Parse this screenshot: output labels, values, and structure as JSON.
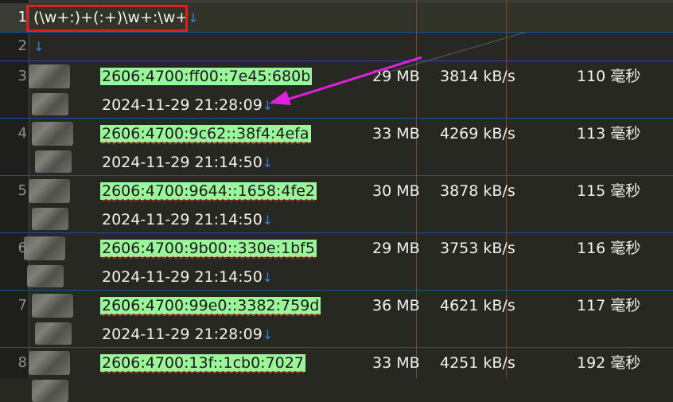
{
  "editor": {
    "line_numbers": [
      "1",
      "2",
      "3",
      "4",
      "5",
      "6",
      "7",
      "8"
    ],
    "regex_line": "(\\w+:)+(:+)\\w+:\\w+",
    "newline_marker": "↓",
    "colors": {
      "background": "#272822",
      "match_highlight": "#9bf59b",
      "arrow_annotation": "#e020e0",
      "regex_box": "#e11d1d",
      "rule_lines": "#1d4ea6",
      "column_guide": "#b36a3a"
    }
  },
  "entries": [
    {
      "line": "3",
      "ip": "2606:4700:ff00::7e45:680b",
      "size": "29 MB",
      "speed": "3814 kB/s",
      "latency": "110 毫秒",
      "date": "2024-11-29 21:28:09"
    },
    {
      "line": "4",
      "ip": "2606:4700:9c62::38f4:4efa",
      "size": "33 MB",
      "speed": "4269 kB/s",
      "latency": "113 毫秒",
      "date": "2024-11-29 21:14:50"
    },
    {
      "line": "5",
      "ip": "2606:4700:9644::1658:4fe2",
      "size": "30 MB",
      "speed": "3878 kB/s",
      "latency": "115 毫秒",
      "date": "2024-11-29 21:14:50"
    },
    {
      "line": "6",
      "ip": "2606:4700:9b00::330e:1bf5",
      "size": "29 MB",
      "speed": "3753 kB/s",
      "latency": "116 毫秒",
      "date": "2024-11-29 21:14:50"
    },
    {
      "line": "7",
      "ip": "2606:4700:99e0::3382:759d",
      "size": "36 MB",
      "speed": "4621 kB/s",
      "latency": "117 毫秒",
      "date": "2024-11-29 21:28:09"
    },
    {
      "line": "8",
      "ip": "2606:4700:13f::1cb0:7027",
      "size": "33 MB",
      "speed": "4251 kB/s",
      "latency": "192 毫秒",
      "date": ""
    }
  ]
}
